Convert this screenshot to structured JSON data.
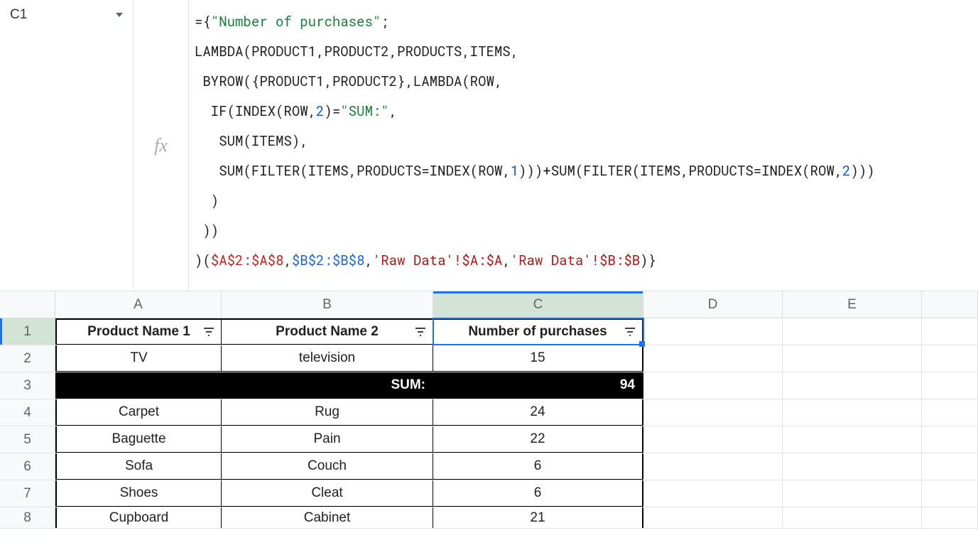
{
  "nameBox": {
    "value": "C1"
  },
  "fxLabel": "fx",
  "formula": {
    "line1_a": "={",
    "line1_b": "\"Number of purchases\"",
    "line1_c": ";",
    "line2": "LAMBDA(PRODUCT1,PRODUCT2,PRODUCTS,ITEMS,",
    "line3": " BYROW({PRODUCT1,PRODUCT2},LAMBDA(ROW,",
    "line4_a": "  IF(INDEX(ROW,",
    "line4_b": "2",
    "line4_c": ")=",
    "line4_d": "\"SUM:\"",
    "line4_e": ",",
    "line5": "   SUM(ITEMS),",
    "line6_a": "   SUM(FILTER(ITEMS,PRODUCTS=INDEX(ROW,",
    "line6_b": "1",
    "line6_c": ")))+SUM(FILTER(ITEMS,PRODUCTS=INDEX(ROW,",
    "line6_d": "2",
    "line6_e": ")))",
    "line7": "  )",
    "line8": " ))",
    "line9_a": ")(",
    "line9_b": "$A$2:$A$8",
    "line9_c": ",",
    "line9_d": "$B$2:$B$8",
    "line9_e": ",",
    "line9_f": "'Raw Data'!$A:$A",
    "line9_g": ",",
    "line9_h": "'Raw Data'!$B:$B",
    "line9_i": ")}"
  },
  "columns": {
    "A": "A",
    "B": "B",
    "C": "C",
    "D": "D",
    "E": "E"
  },
  "rowNums": {
    "1": "1",
    "2": "2",
    "3": "3",
    "4": "4",
    "5": "5",
    "6": "6",
    "7": "7",
    "8": "8"
  },
  "headers": {
    "A": "Product Name 1",
    "B": "Product Name 2",
    "C": "Number of purchases"
  },
  "rows": {
    "r2": {
      "A": "TV",
      "B": "television",
      "C": "15"
    },
    "r3": {
      "B": "SUM:",
      "C": "94"
    },
    "r4": {
      "A": "Carpet",
      "B": "Rug",
      "C": "24"
    },
    "r5": {
      "A": "Baguette",
      "B": "Pain",
      "C": "22"
    },
    "r6": {
      "A": "Sofa",
      "B": "Couch",
      "C": "6"
    },
    "r7": {
      "A": "Shoes",
      "B": "Cleat",
      "C": "6"
    },
    "r8": {
      "A": "Cupboard",
      "B": "Cabinet",
      "C": "21"
    }
  }
}
